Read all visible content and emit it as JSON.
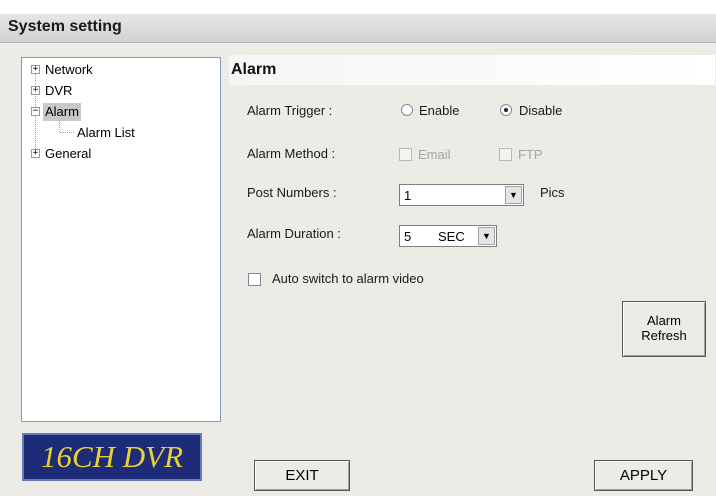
{
  "window": {
    "title": "System setting"
  },
  "tree": {
    "items": [
      {
        "label": "Network",
        "expander": "+"
      },
      {
        "label": "DVR",
        "expander": "+"
      },
      {
        "label": "Alarm",
        "expander": "−"
      },
      {
        "label": "Alarm List"
      },
      {
        "label": "General",
        "expander": "+"
      }
    ]
  },
  "logo": {
    "text": "16CH DVR"
  },
  "panel": {
    "title": "Alarm",
    "alarm_trigger": {
      "label": "Alarm Trigger :",
      "options": [
        "Enable",
        "Disable"
      ],
      "selected": "Disable"
    },
    "alarm_method": {
      "label": "Alarm Method :",
      "options": [
        "Email",
        "FTP"
      ]
    },
    "post_numbers": {
      "label": "Post Numbers :",
      "value": "1",
      "unit": "Pics"
    },
    "alarm_duration": {
      "label": "Alarm Duration :",
      "value": "5",
      "unit": "SEC"
    },
    "auto_switch": {
      "label": "Auto switch to alarm video",
      "checked": false
    },
    "alarm_refresh": {
      "line1": "Alarm",
      "line2": "Refresh"
    }
  },
  "buttons": {
    "exit": "EXIT",
    "apply": "APPLY"
  }
}
